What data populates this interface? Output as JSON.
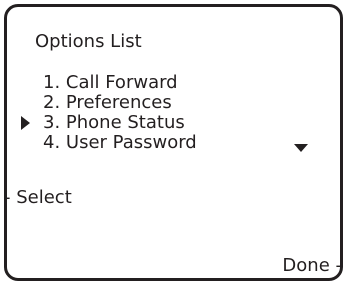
{
  "screen": {
    "title": "Options List"
  },
  "options": [
    {
      "label": "1. Call Forward",
      "selected": false
    },
    {
      "label": "2. Preferences",
      "selected": false
    },
    {
      "label": "3. Phone Status",
      "selected": true
    },
    {
      "label": "4. User Password",
      "selected": false
    }
  ],
  "indicators": {
    "cursor_icon": "right-triangle-icon",
    "scroll_icon": "down-triangle-icon"
  },
  "softkeys": {
    "left_label": "- Select",
    "right_label": "Done -"
  }
}
